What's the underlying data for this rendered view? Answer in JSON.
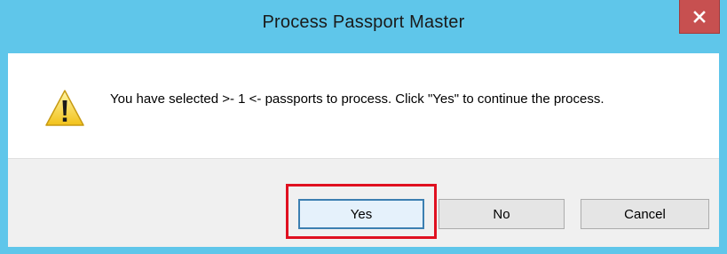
{
  "window": {
    "title": "Process Passport Master",
    "frame_color": "#5fc6ea",
    "close_button_color": "#c75050",
    "close_icon": "close-icon"
  },
  "dialog": {
    "icon": "warning-icon",
    "message": "You have selected >- 1 <- passports to process. Click \"Yes\" to continue the process."
  },
  "buttons": {
    "yes_label": "Yes",
    "no_label": "No",
    "cancel_label": "Cancel",
    "default_button": "Yes"
  },
  "annotation": {
    "highlight_target": "Yes",
    "highlight_color": "#e01020"
  }
}
